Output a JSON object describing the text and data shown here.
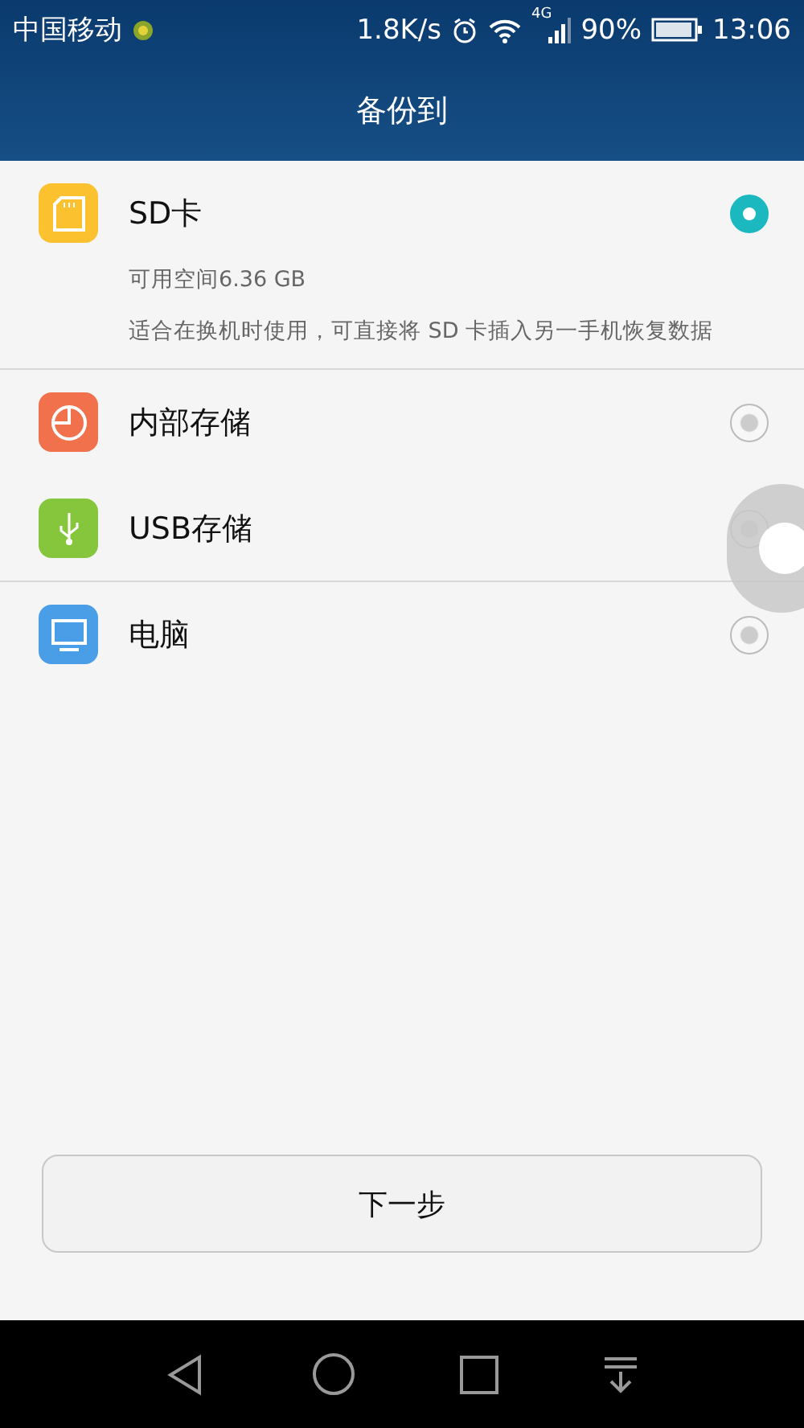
{
  "status_bar": {
    "carrier": "中国移动",
    "speed": "1.8K/s",
    "network": "4G",
    "battery": "90%",
    "time": "13:06"
  },
  "header": {
    "title": "备份到"
  },
  "options": [
    {
      "kind": "sd",
      "label": "SD卡",
      "color": "#fbc12f",
      "selected": true,
      "divider": true,
      "details": [
        "可用空间6.36 GB",
        "适合在换机时使用，可直接将 SD 卡插入另一手机恢复数据"
      ]
    },
    {
      "kind": "internal",
      "label": "内部存储",
      "color": "#f0714c",
      "selected": false,
      "divider": false
    },
    {
      "kind": "usb",
      "label": "USB存储",
      "color": "#86c63d",
      "selected": false,
      "divider": true
    },
    {
      "kind": "pc",
      "label": "电脑",
      "color": "#4a9ee8",
      "selected": false,
      "divider": false
    }
  ],
  "next_button": {
    "label": "下一步"
  },
  "floating_button": {
    "on": true
  }
}
